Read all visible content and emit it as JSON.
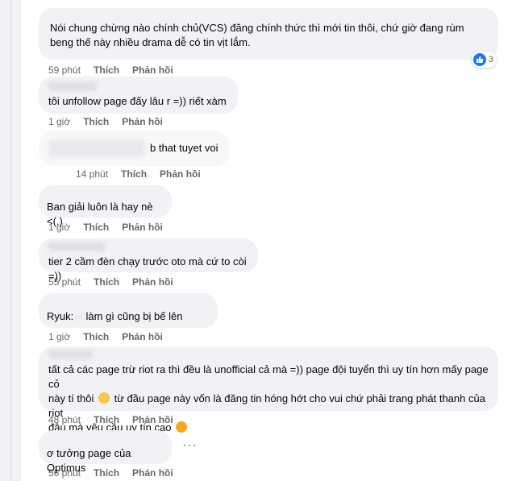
{
  "action_labels": {
    "like": "Thích",
    "reply": "Phản hồi"
  },
  "comments": [
    {
      "text": "Nói chung chừng nào chính chủ(VCS) đăng chính thức thì mới tin thôi, chứ giờ đang rùm beng thế này nhiều drama dễ có tin vịt lắm.",
      "time": "59 phút",
      "reaction_count": "3"
    },
    {
      "text": "tôi unfollow page đấy lâu r =)) riết xàm",
      "time": "1 giờ"
    },
    {
      "text": "b that tuyet voi",
      "time": "14 phút"
    },
    {
      "text": "Ban giải luôn là hay nè <(.)",
      "time": "1 giờ"
    },
    {
      "text": "tier 2 cầm đèn chạy trước oto mà cứ to còi =))",
      "time": "55 phút"
    },
    {
      "author": "Ryuk:",
      "text": "làm gì cũng bị bế lên",
      "time": "1 giờ"
    },
    {
      "text_1": "tất cả các page trừ riot ra thì đều là unofficial cả mà =)) page đội tuyển thì uy tín hơn mấy page cỏ",
      "text_2a": "này tí thôi",
      "text_2b": "từ đầu page này vốn là đăng tin hóng hớt cho vui chứ phải trang phát thanh của riot",
      "text_3": "đâu mà yêu cầu uy tín cao",
      "time": "48 phút"
    },
    {
      "text": "ơ tưởng page của Optimus",
      "time": "56 phút",
      "more": "···"
    }
  ],
  "colors": {
    "bubble": "#f0f2f5",
    "meta": "#65676b",
    "like_blue": "#1877f2"
  },
  "icons": {
    "reaction": "like-icon",
    "emoji_1": "smiling-face-emoji",
    "emoji_2": "rolling-laughing-emoji",
    "more": "more-options-icon"
  }
}
